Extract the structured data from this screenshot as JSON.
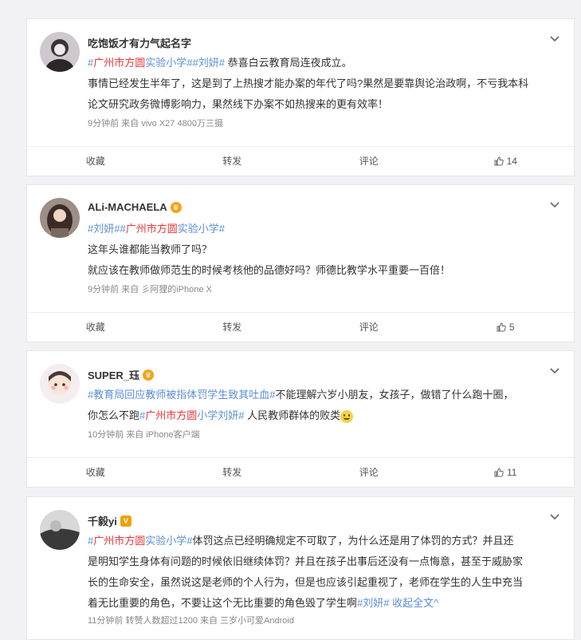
{
  "posts": [
    {
      "user": "吃饱饭才有力气起名字",
      "content_parts": [
        {
          "t": "#",
          "c": "tag"
        },
        {
          "t": "广州市方圆",
          "c": "hl"
        },
        {
          "t": "实验小学##刘妍#",
          "c": "tag"
        },
        {
          "t": " 恭喜白云教育局连夜成立。",
          "c": "plain"
        }
      ],
      "lines": [
        "事情已经发生半年了，这是到了上热搜才能办案的年代了吗?果然是要靠舆论治政啊，不亏我本科",
        "论文研究政务微博影响力，果然线下办案不如热搜来的更有效率！"
      ],
      "meta": "9分钟前   来自 vivo X27 4800万三摄",
      "actions": {
        "collect": "收藏",
        "repost": "转发",
        "comment": "评论",
        "likes": "14"
      }
    },
    {
      "user": "ALi-MACHAELA",
      "content_parts": [
        {
          "t": "#刘妍##",
          "c": "tag"
        },
        {
          "t": "广州市方圆",
          "c": "hl"
        },
        {
          "t": "实验小学#",
          "c": "tag"
        }
      ],
      "lines": [
        "这年头谁都能当教师了吗？",
        "就应该在教师做师范生的时候考核他的品德好吗？师德比教学水平重要一百倍！"
      ],
      "meta": "9分钟前   来自 彡阿狸的iPhone X",
      "actions": {
        "collect": "收藏",
        "repost": "转发",
        "comment": "评论",
        "likes": "5"
      }
    },
    {
      "user": "SUPER_珏",
      "content_parts": [
        {
          "t": "#教育局回应教师被指体罚学生致其吐血#",
          "c": "tag"
        },
        {
          "t": "不能理解六岁小朋友，女孩子，做错了什么跑十圈，",
          "c": "plain"
        }
      ],
      "line2_parts": [
        {
          "t": "你怎么不跑",
          "c": "plain"
        },
        {
          "t": "#",
          "c": "tag"
        },
        {
          "t": "广州市方圆",
          "c": "hl"
        },
        {
          "t": "小学刘妍#",
          "c": "tag"
        },
        {
          "t": " 人民教师群体的败类",
          "c": "plain"
        }
      ],
      "meta": "10分钟前   来自 iPhone客户端",
      "actions": {
        "collect": "收藏",
        "repost": "转发",
        "comment": "评论",
        "likes": "11"
      }
    },
    {
      "user": "千毅yi",
      "content_parts": [
        {
          "t": "#",
          "c": "tag"
        },
        {
          "t": "广州市方圆",
          "c": "hl"
        },
        {
          "t": "实验小学#",
          "c": "tag"
        },
        {
          "t": "体罚这点已经明确规定不可取了，为什么还是用了体罚的方式？并且还",
          "c": "plain"
        }
      ],
      "lines": [
        "是明知学生身体有问题的时候依旧继续体罚？并且在孩子出事后还没有一点悔意，甚至于威胁家",
        "长的生命安全，虽然说这是老师的个人行为，但是也应该引起重视了，老师在学生的人生中充当"
      ],
      "last_parts": [
        {
          "t": "着无比重要的角色，不要让这个无比重要的角色毁了学生啊",
          "c": "plain"
        },
        {
          "t": "#刘妍# 收起全文",
          "c": "tag"
        },
        {
          "t": "^",
          "c": "tag"
        }
      ],
      "meta": "11分钟前   转赞人数超过1200   来自 三岁小可爱Android"
    }
  ]
}
